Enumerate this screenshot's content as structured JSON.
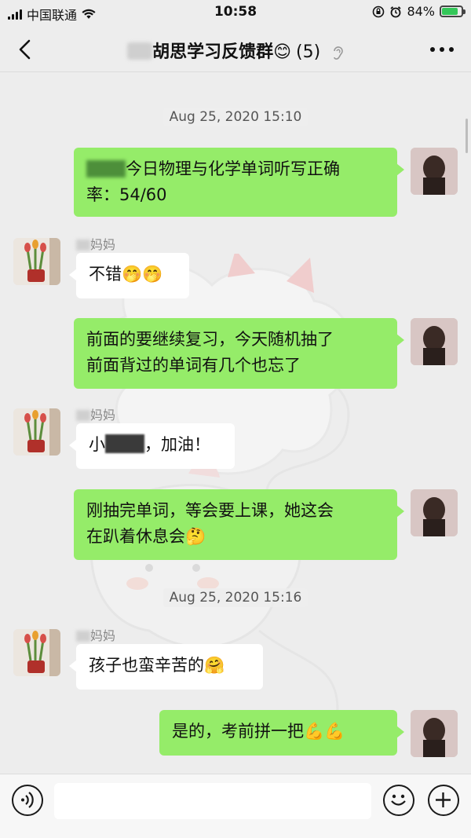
{
  "status_bar": {
    "carrier": "中国联通",
    "time": "10:58",
    "battery": "84%",
    "battery_level": 0.84
  },
  "header": {
    "title": "胡思学习反馈群😊",
    "member_count": "(5)",
    "back_icon": "chevron-left-icon",
    "more_icon": "more-icon"
  },
  "messages": {
    "ts1": "Aug 25, 2020 15:10",
    "m1": "今日物理与化学单词听写正确\n率：54/60",
    "n2": "妈妈",
    "m2": "不错🤭🤭",
    "m3": "前面的要继续复习，今天随机抽了\n前面背过的单词有几个也忘了",
    "n4": "妈妈",
    "m4_pre": "小",
    "m4_post": "，加油！",
    "m5": "刚抽完单词，等会要上课，她这会\n在趴着休息会🤔",
    "ts2": "Aug 25, 2020 15:16",
    "n6": "妈妈",
    "m6": "孩子也蛮辛苦的🤗",
    "m7": "是的，考前拼一把💪💪"
  },
  "input_bar": {
    "placeholder": "",
    "voice_icon": "voice-icon",
    "emoji_icon": "emoji-icon",
    "plus_icon": "plus-icon"
  },
  "colors": {
    "my_bubble": "#95ec69",
    "other_bubble": "#ffffff",
    "background": "#ededed"
  }
}
